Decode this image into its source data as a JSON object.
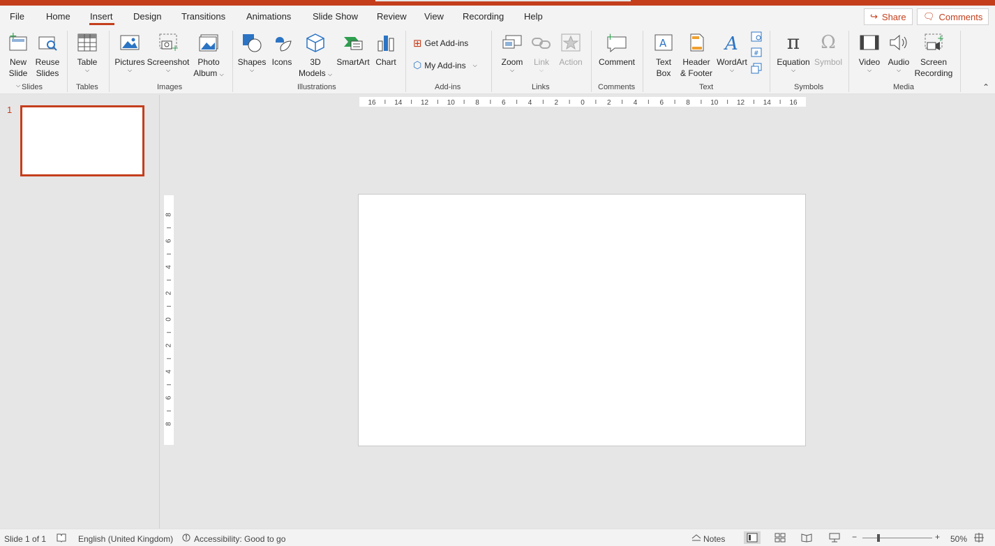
{
  "tabs": [
    "File",
    "Home",
    "Insert",
    "Design",
    "Transitions",
    "Animations",
    "Slide Show",
    "Review",
    "View",
    "Recording",
    "Help"
  ],
  "active_tab": "Insert",
  "top_buttons": {
    "share": "Share",
    "comments": "Comments"
  },
  "ribbon": {
    "slides": {
      "new_slide_1": "New",
      "new_slide_2": "Slide",
      "reuse_1": "Reuse",
      "reuse_2": "Slides",
      "group": "Slides"
    },
    "tables": {
      "table": "Table",
      "group": "Tables"
    },
    "images": {
      "pictures": "Pictures",
      "screenshot": "Screenshot",
      "photo_album_1": "Photo",
      "photo_album_2": "Album",
      "group": "Images"
    },
    "illustrations": {
      "shapes": "Shapes",
      "icons": "Icons",
      "models_1": "3D",
      "models_2": "Models",
      "smartart": "SmartArt",
      "chart": "Chart",
      "group": "Illustrations"
    },
    "addins": {
      "get": "Get Add-ins",
      "my": "My Add-ins",
      "group": "Add-ins"
    },
    "links": {
      "zoom": "Zoom",
      "link": "Link",
      "action": "Action",
      "group": "Links"
    },
    "comments": {
      "comment": "Comment",
      "group": "Comments"
    },
    "text": {
      "textbox_1": "Text",
      "textbox_2": "Box",
      "header_1": "Header",
      "header_2": "& Footer",
      "wordart": "WordArt",
      "group": "Text"
    },
    "symbols": {
      "equation": "Equation",
      "symbol": "Symbol",
      "group": "Symbols"
    },
    "media": {
      "video": "Video",
      "audio": "Audio",
      "screen_1": "Screen",
      "screen_2": "Recording",
      "group": "Media"
    }
  },
  "rulers": {
    "horizontal": [
      "16",
      "14",
      "12",
      "10",
      "8",
      "6",
      "4",
      "2",
      "0",
      "2",
      "4",
      "6",
      "8",
      "10",
      "12",
      "14",
      "16"
    ],
    "vertical": [
      "8",
      "6",
      "4",
      "2",
      "0",
      "2",
      "4",
      "6",
      "8"
    ]
  },
  "thumbnail": {
    "number": "1"
  },
  "status": {
    "slide": "Slide 1 of 1",
    "language": "English (United Kingdom)",
    "accessibility": "Accessibility: Good to go",
    "notes": "Notes",
    "zoom": "50%"
  },
  "colors": {
    "accent": "#c43e1c",
    "icon_blue": "#2b74c4",
    "icon_green": "#2e9e4f"
  }
}
